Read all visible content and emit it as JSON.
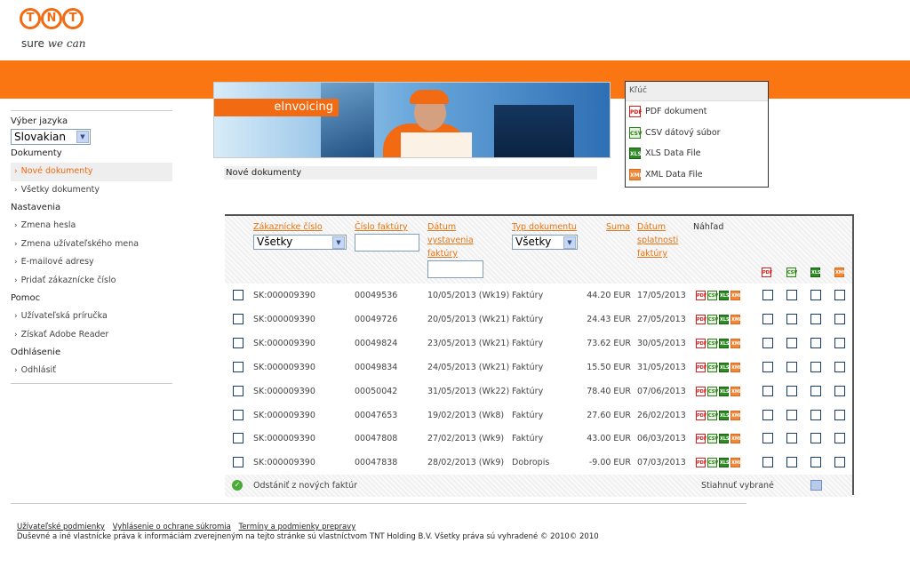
{
  "logo": {
    "letters": [
      "T",
      "N",
      "T"
    ],
    "tagline_a": "sure ",
    "tagline_b": "we can"
  },
  "nav": {
    "lang_label": "Výber jazyka",
    "lang_value": "Slovakian",
    "sections": [
      {
        "title": "Dokumenty",
        "items": [
          "Nové dokumenty",
          "Všetky dokumenty"
        ]
      },
      {
        "title": "Nastavenia",
        "items": [
          "Zmena hesla",
          "Zmena užívateľského mena",
          "E-mailové adresy",
          "Pridať zákaznícke číslo"
        ]
      },
      {
        "title": "Pomoc",
        "items": [
          "Užívateľská príručka",
          "Získať Adobe Reader"
        ]
      },
      {
        "title": "Odhlásenie",
        "items": [
          "Odhlásiť"
        ]
      }
    ],
    "active": "Nové dokumenty"
  },
  "banner": {
    "label": "eInvoicing"
  },
  "page_title": "Nové dokumenty",
  "key": {
    "title": "Kľúč",
    "items": [
      {
        "icon": "pdf-icon",
        "label": "PDF dokument"
      },
      {
        "icon": "csv-icon",
        "label": "CSV dátový súbor"
      },
      {
        "icon": "xls-icon",
        "label": "XLS Data File"
      },
      {
        "icon": "xml-icon",
        "label": "XML Data File"
      }
    ]
  },
  "table": {
    "headers": {
      "customer": "Zákaznícke číslo",
      "invoice": "Číslo faktúry",
      "issued": "Dátum vystavenia faktúry",
      "type": "Typ dokumentu",
      "amount": "Suma",
      "due": "Dátum splatnosti faktúry",
      "preview": "Náhľad"
    },
    "filters": {
      "customer": "Všetky",
      "type": "Všetky"
    },
    "rows": [
      {
        "customer": "SK:000009390",
        "invoice": "00049536",
        "issued": "10/05/2013 (Wk19)",
        "type": "Faktúry",
        "amount": "44.20 EUR",
        "due": "17/05/2013"
      },
      {
        "customer": "SK:000009390",
        "invoice": "00049726",
        "issued": "20/05/2013 (Wk21)",
        "type": "Faktúry",
        "amount": "24.43 EUR",
        "due": "27/05/2013"
      },
      {
        "customer": "SK:000009390",
        "invoice": "00049824",
        "issued": "23/05/2013 (Wk21)",
        "type": "Faktúry",
        "amount": "73.62 EUR",
        "due": "30/05/2013"
      },
      {
        "customer": "SK:000009390",
        "invoice": "00049834",
        "issued": "24/05/2013 (Wk21)",
        "type": "Faktúry",
        "amount": "15.50 EUR",
        "due": "31/05/2013"
      },
      {
        "customer": "SK:000009390",
        "invoice": "00050042",
        "issued": "31/05/2013 (Wk22)",
        "type": "Faktúry",
        "amount": "78.40 EUR",
        "due": "07/06/2013"
      },
      {
        "customer": "SK:000009390",
        "invoice": "00047653",
        "issued": "19/02/2013 (Wk8)",
        "type": "Faktúry",
        "amount": "27.60 EUR",
        "due": "26/02/2013"
      },
      {
        "customer": "SK:000009390",
        "invoice": "00047808",
        "issued": "27/02/2013 (Wk9)",
        "type": "Faktúry",
        "amount": "43.00 EUR",
        "due": "06/03/2013"
      },
      {
        "customer": "SK:000009390",
        "invoice": "00047838",
        "issued": "28/02/2013 (Wk9)",
        "type": "Dobropis",
        "amount": "-9.00 EUR",
        "due": "07/03/2013"
      }
    ],
    "remove_label": "Odstániť z nových faktúr",
    "download_label": "Stiahnuť vybrané"
  },
  "icon_text": {
    "pdf": "PDF",
    "csv": "CSV",
    "xls": "XLS",
    "xml": "XML"
  },
  "footer": {
    "links": [
      "Užívateľské podmienky",
      "Vyhlásenie o ochrane súkromia",
      "Termíny a podmienky prepravy"
    ],
    "copyright": "Duševné a iné vlastnícke práva k informáciám zverejneným na tejto stránke sú vlastníctvom TNT Holding B.V. Všetky práva sú vyhradené © 2010© 2010"
  },
  "colors": {
    "brand": "#f97612",
    "link": "#e8720f"
  }
}
